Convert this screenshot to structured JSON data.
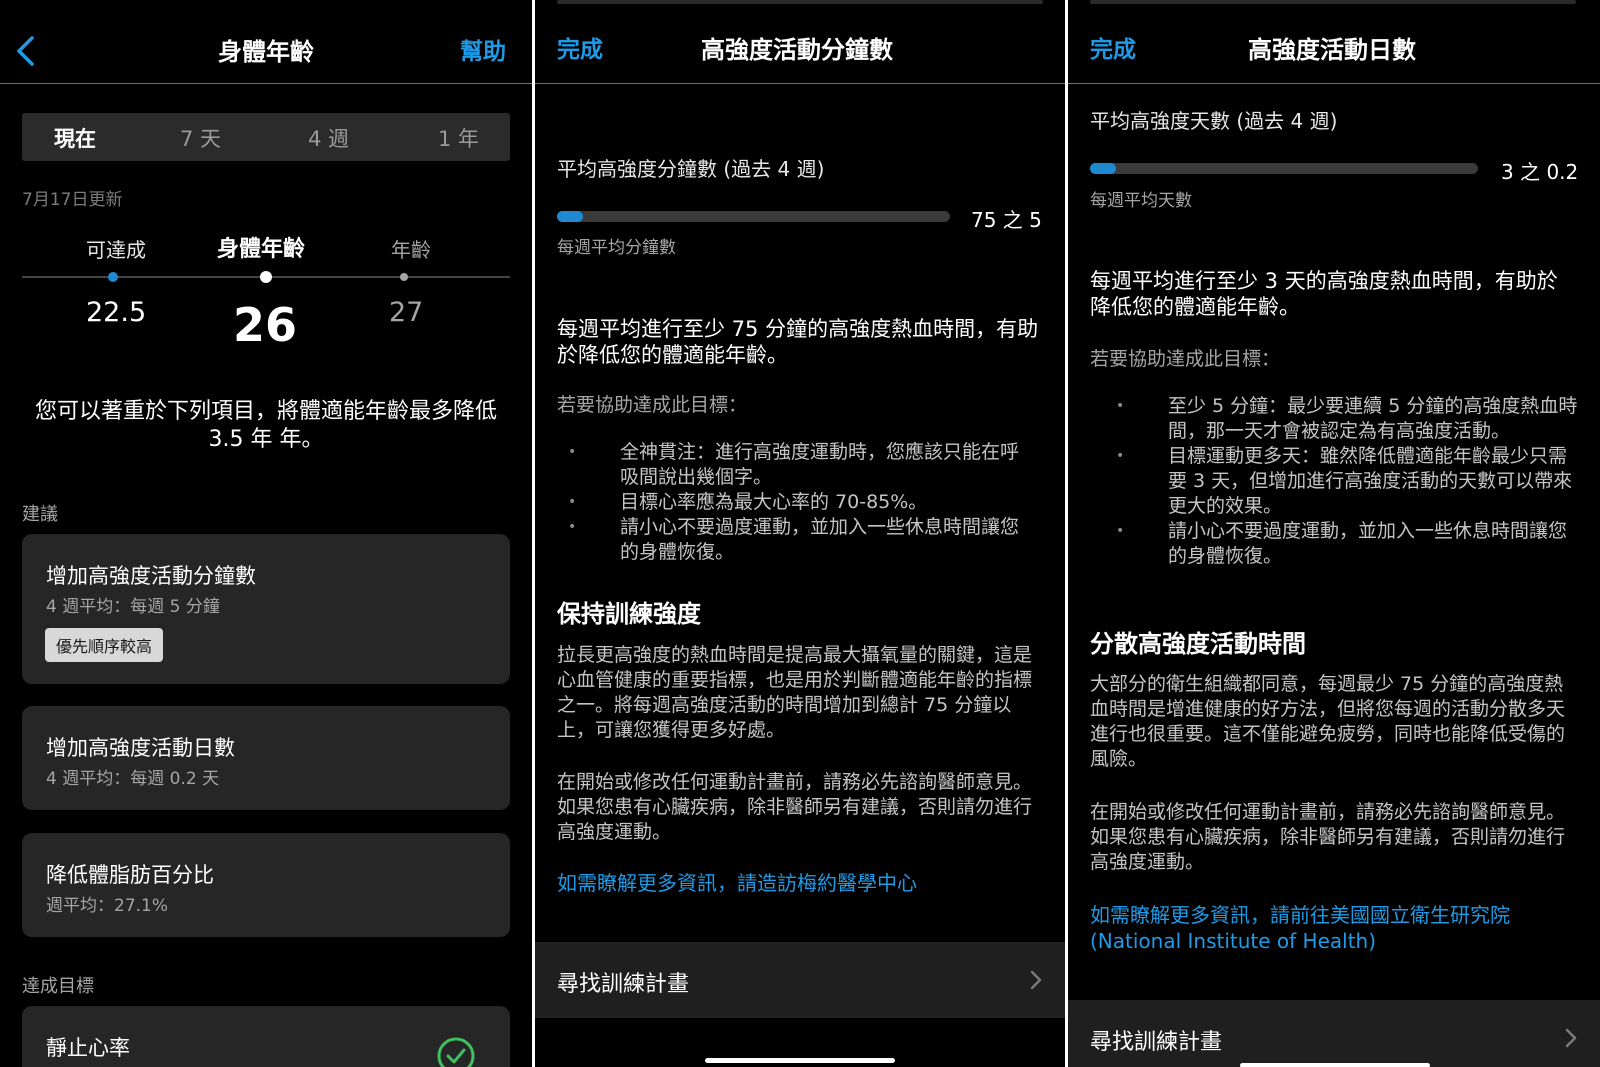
{
  "panel1": {
    "header": {
      "title": "身體年齡",
      "help": "幫助"
    },
    "tabs": [
      {
        "label": "現在",
        "active": true
      },
      {
        "label": "7 天",
        "active": false
      },
      {
        "label": "4 週",
        "active": false
      },
      {
        "label": "1 年",
        "active": false
      }
    ],
    "updated": "7月17日更新",
    "scale": {
      "achievable_label": "可達成",
      "body_age_label": "身體年齡",
      "age_label": "年齡",
      "achievable_value": "22.5",
      "body_age_value": "26",
      "age_value": "27"
    },
    "note": "您可以著重於下列項目，將體適能年齡最多降低 3.5 年 年。",
    "suggestions_label": "建議",
    "cards": [
      {
        "title": "增加高強度活動分鐘數",
        "sub": "4 週平均：每週 5 分鐘",
        "badge": "優先順序較高"
      },
      {
        "title": "增加高強度活動日數",
        "sub": "4 週平均：每週 0.2 天"
      },
      {
        "title": "降低體脂肪百分比",
        "sub": "週平均：27.1%"
      }
    ],
    "achieved_label": "達成目標",
    "achieved_card": {
      "title": "靜止心率"
    },
    "colors": {
      "accent": "#1f8ad1",
      "link": "#1f9ae6"
    }
  },
  "panel2": {
    "header": {
      "done": "完成",
      "title": "高強度活動分鐘數"
    },
    "section": "平均高強度分鐘數 (過去 4 週)",
    "progress": {
      "value": 5,
      "target": 75,
      "fraction": 0.067,
      "text": "75 之 5",
      "caption": "每週平均分鐘數"
    },
    "intro": "每週平均進行至少 75 分鐘的高強度熱血時間，有助於降低您的體適能年齡。",
    "tips_head": "若要協助達成此目標：",
    "tips": [
      "全神貫注：進行高強度運動時，您應該只能在呼吸間說出幾個字。",
      "目標心率應為最大心率的 70-85%。",
      "請小心不要過度運動，並加入一些休息時間讓您的身體恢復。"
    ],
    "heading": "保持訓練強度",
    "para1": "拉長更高強度的熱血時間是提高最大攝氧量的關鍵，這是心血管健康的重要指標，也是用於判斷體適能年齡的指標之一。將每週高強度活動的時間增加到總計 75 分鐘以上，可讓您獲得更多好處。",
    "para2": "在開始或修改任何運動計畫前，請務必先諮詢醫師意見。如果您患有心臟疾病，除非醫師另有建議，否則請勿進行高強度運動。",
    "link": "如需瞭解更多資訊，請造訪梅約醫學中心",
    "row": "尋找訓練計畫"
  },
  "panel3": {
    "header": {
      "done": "完成",
      "title": "高強度活動日數"
    },
    "section": "平均高強度天數 (過去 4 週)",
    "progress": {
      "value": 0.2,
      "target": 3,
      "fraction": 0.067,
      "text": "3 之 0.2",
      "caption": "每週平均天數"
    },
    "intro": "每週平均進行至少 3 天的高強度熱血時間，有助於降低您的體適能年齡。",
    "tips_head": "若要協助達成此目標：",
    "tips": [
      "至少 5 分鐘：最少要連續 5 分鐘的高強度熱血時間，那一天才會被認定為有高強度活動。",
      "目標運動更多天：雖然降低體適能年齡最少只需要 3 天，但增加進行高強度活動的天數可以帶來更大的效果。",
      "請小心不要過度運動，並加入一些休息時間讓您的身體恢復。"
    ],
    "heading": "分散高強度活動時間",
    "para1": "大部分的衛生組織都同意，每週最少 75 分鐘的高強度熱血時間是增進健康的好方法，但將您每週的活動分散多天進行也很重要。這不僅能避免疲勞，同時也能降低受傷的風險。",
    "para2": "在開始或修改任何運動計畫前，請務必先諮詢醫師意見。如果您患有心臟疾病，除非醫師另有建議，否則請勿進行高強度運動。",
    "link": "如需瞭解更多資訊，請前往美國國立衛生研究院 (National Institute of Health)",
    "row": "尋找訓練計畫"
  }
}
